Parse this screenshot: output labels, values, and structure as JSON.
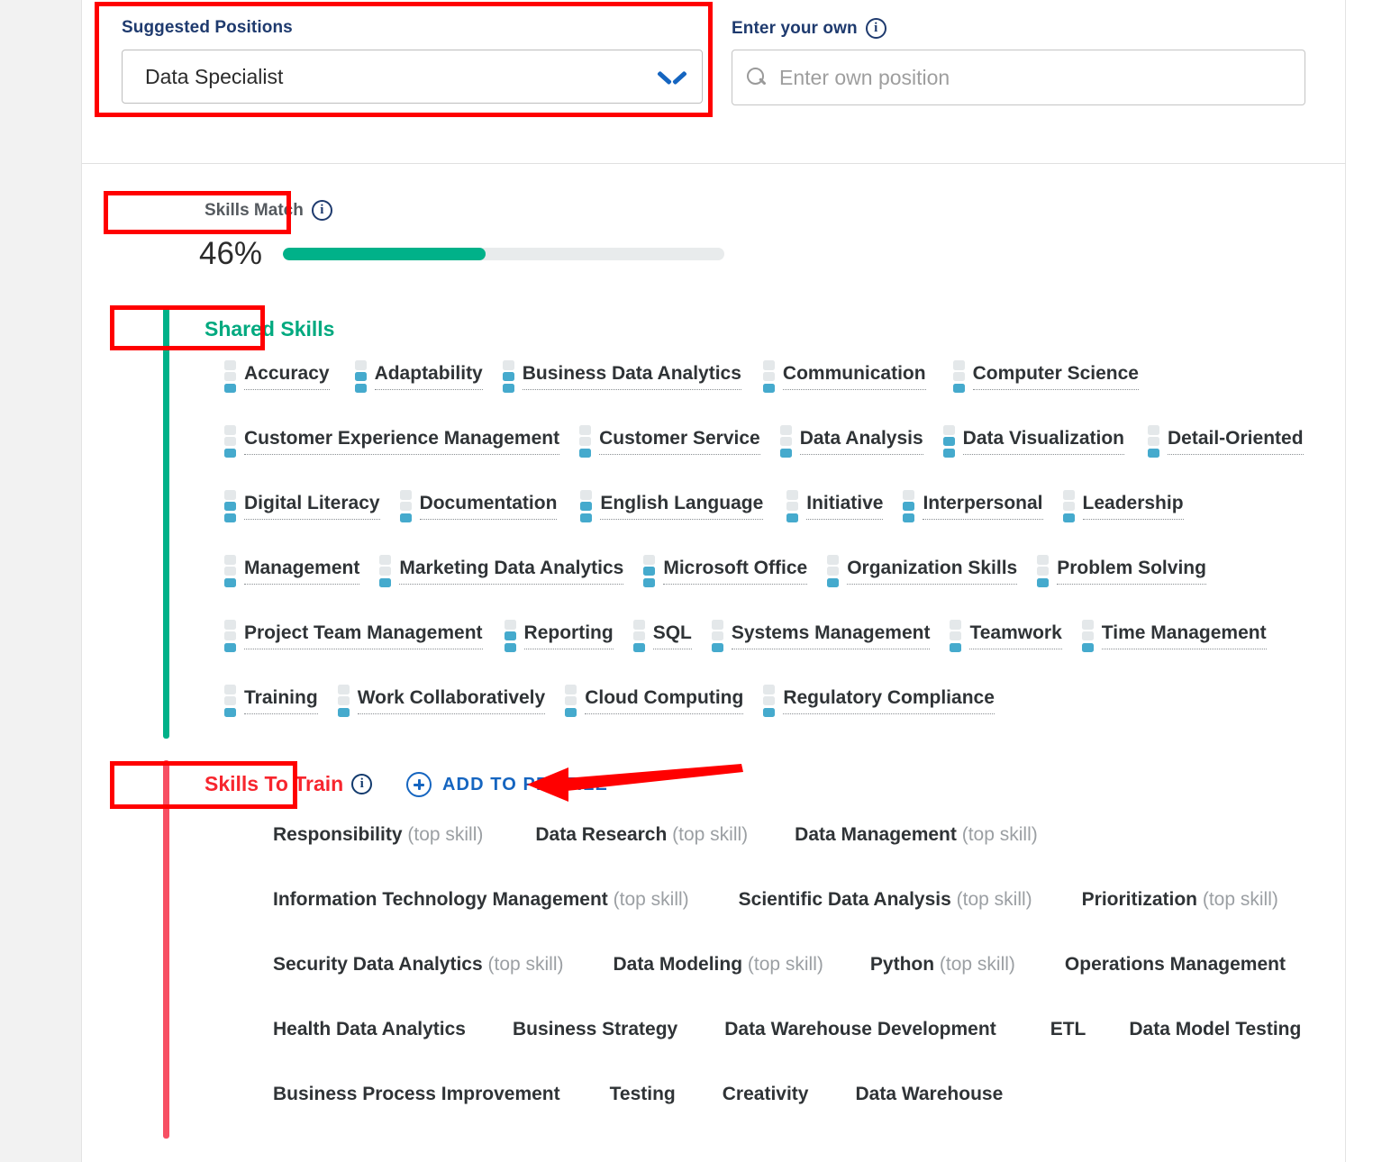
{
  "position_section": {
    "suggested_label": "Suggested Positions",
    "selected_position": "Data Specialist",
    "own_label": "Enter your own",
    "own_placeholder": "Enter own position",
    "select_icon": "chevron-down-icon",
    "search_icon": "search-icon",
    "info_icon": "info-icon",
    "info_glyph": "i"
  },
  "skills_match": {
    "label": "Skills Match",
    "percent_text": "46%",
    "percent_value": 46,
    "fill_color": "#00b189",
    "track_color": "#e8ebec"
  },
  "shared_skills": {
    "title": "Shared Skills",
    "rail_color": "#00b189",
    "rows": [
      [
        {
          "name": "Accuracy",
          "level": 1
        },
        {
          "name": "Adaptability",
          "level": 2
        },
        {
          "name": "Business Data Analytics",
          "level": 2
        },
        {
          "name": "Communication",
          "level": 1
        },
        {
          "name": "Computer Science",
          "level": 1
        }
      ],
      [
        {
          "name": "Customer Experience Management",
          "level": 1
        },
        {
          "name": "Customer Service",
          "level": 1
        },
        {
          "name": "Data Analysis",
          "level": 1
        },
        {
          "name": "Data Visualization",
          "level": 2
        },
        {
          "name": "Detail-Oriented",
          "level": 1
        }
      ],
      [
        {
          "name": "Digital Literacy",
          "level": 2
        },
        {
          "name": "Documentation",
          "level": 1
        },
        {
          "name": "English Language",
          "level": 2
        },
        {
          "name": "Initiative",
          "level": 1
        },
        {
          "name": "Interpersonal",
          "level": 2
        },
        {
          "name": "Leadership",
          "level": 1
        }
      ],
      [
        {
          "name": "Management",
          "level": 1
        },
        {
          "name": "Marketing Data Analytics",
          "level": 1
        },
        {
          "name": "Microsoft Office",
          "level": 2
        },
        {
          "name": "Organization Skills",
          "level": 1
        },
        {
          "name": "Problem Solving",
          "level": 1
        }
      ],
      [
        {
          "name": "Project Team Management",
          "level": 1
        },
        {
          "name": "Reporting",
          "level": 2
        },
        {
          "name": "SQL",
          "level": 1
        },
        {
          "name": "Systems Management",
          "level": 1
        },
        {
          "name": "Teamwork",
          "level": 1
        },
        {
          "name": "Time Management",
          "level": 1
        }
      ],
      [
        {
          "name": "Training",
          "level": 1
        },
        {
          "name": "Work Collaboratively",
          "level": 1
        },
        {
          "name": "Cloud Computing",
          "level": 1
        },
        {
          "name": "Regulatory Compliance",
          "level": 1
        }
      ]
    ]
  },
  "skills_to_train": {
    "title": "Skills To Train",
    "add_label": "ADD TO PROFILE",
    "add_icon": "plus-circle-icon",
    "rail_color": "#f74f63",
    "top_skill_suffix": "(top skill)",
    "rows": [
      [
        {
          "name": "Responsibility",
          "top": true
        },
        {
          "name": "Data Research",
          "top": true
        },
        {
          "name": "Data Management",
          "top": true
        }
      ],
      [
        {
          "name": "Information Technology Management",
          "top": true
        },
        {
          "name": "Scientific Data Analysis",
          "top": true
        },
        {
          "name": "Prioritization",
          "top": true
        }
      ],
      [
        {
          "name": "Security Data Analytics",
          "top": true
        },
        {
          "name": "Data Modeling",
          "top": true
        },
        {
          "name": "Python",
          "top": true
        },
        {
          "name": "Operations Management",
          "top": false
        }
      ],
      [
        {
          "name": "Health Data Analytics",
          "top": false
        },
        {
          "name": "Business Strategy",
          "top": false
        },
        {
          "name": "Data Warehouse Development",
          "top": false
        },
        {
          "name": "ETL",
          "top": false
        },
        {
          "name": "Data Model Testing",
          "top": false
        }
      ],
      [
        {
          "name": "Business Process Improvement",
          "top": false
        },
        {
          "name": "Testing",
          "top": false
        },
        {
          "name": "Creativity",
          "top": false
        },
        {
          "name": "Data Warehouse",
          "top": false
        }
      ]
    ]
  },
  "annotations": {
    "color": "#ff0000",
    "arrow_name": "red-pointer-arrow"
  }
}
